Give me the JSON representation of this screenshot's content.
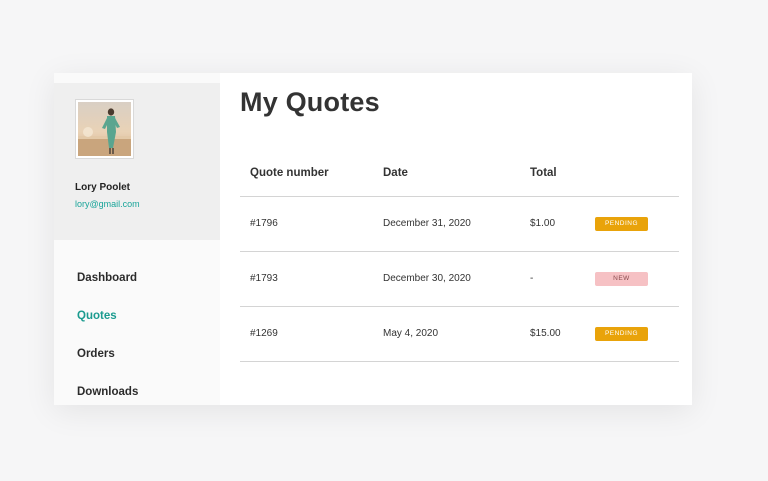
{
  "user": {
    "name": "Lory Poolet",
    "email": "lory@gmail.com"
  },
  "nav": {
    "items": [
      {
        "label": "Dashboard",
        "active": false
      },
      {
        "label": "Quotes",
        "active": true
      },
      {
        "label": "Orders",
        "active": false
      },
      {
        "label": "Downloads",
        "active": false
      }
    ]
  },
  "page": {
    "title": "My Quotes"
  },
  "table": {
    "headers": [
      "Quote number",
      "Date",
      "Total",
      ""
    ],
    "rows": [
      {
        "quote": "#1796",
        "date": "December 31, 2020",
        "total": "$1.00",
        "status": "PENDING"
      },
      {
        "quote": "#1793",
        "date": "December 30, 2020",
        "total": "-",
        "status": "NEW"
      },
      {
        "quote": "#1269",
        "date": "May 4, 2020",
        "total": "$15.00",
        "status": "PENDING"
      }
    ]
  },
  "colors": {
    "accent": "#1b9b8f",
    "pending": "#e9a30a",
    "new": "#f6c1c4"
  }
}
